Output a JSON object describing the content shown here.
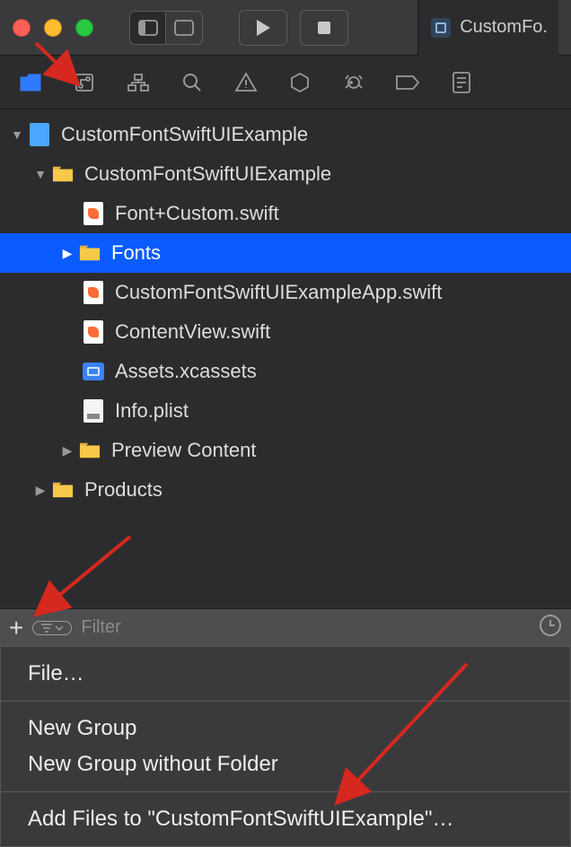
{
  "titlebar": {
    "tab_label": "CustomFo."
  },
  "navigator": {
    "project": "CustomFontSwiftUIExample",
    "group": "CustomFontSwiftUIExample",
    "files": {
      "font_custom": "Font+Custom.swift",
      "fonts_folder": "Fonts",
      "app": "CustomFontSwiftUIExampleApp.swift",
      "contentview": "ContentView.swift",
      "assets": "Assets.xcassets",
      "info": "Info.plist",
      "preview": "Preview Content"
    },
    "products": "Products"
  },
  "filter": {
    "placeholder": "Filter"
  },
  "menu": {
    "file": "File…",
    "new_group": "New Group",
    "new_group_no_folder": "New Group without Folder",
    "add_files": "Add Files to \"CustomFontSwiftUIExample\"…"
  }
}
